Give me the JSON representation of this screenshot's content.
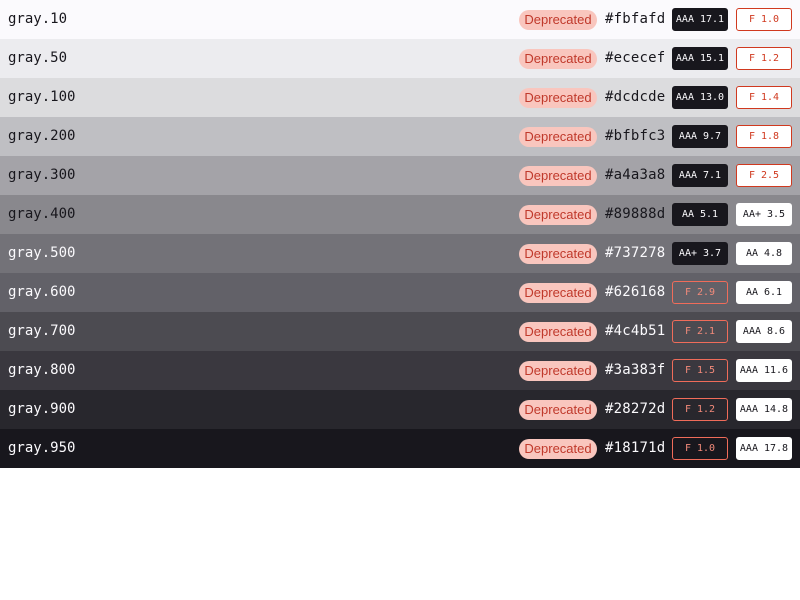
{
  "deprecated_label": "Deprecated",
  "colors": {
    "badge_bg": "#f9c6be",
    "badge_text": "#c0392b",
    "fail_border": "#d0391f"
  },
  "rows": [
    {
      "name": "gray.10",
      "hex": "#fbfafd",
      "bg": "#fbfafd",
      "fg": "#18171d",
      "dark_chip": "AAA 17.1",
      "light_chip": "F 1.0"
    },
    {
      "name": "gray.50",
      "hex": "#ececef",
      "bg": "#ececef",
      "fg": "#18171d",
      "dark_chip": "AAA 15.1",
      "light_chip": "F 1.2"
    },
    {
      "name": "gray.100",
      "hex": "#dcdcde",
      "bg": "#dcdcde",
      "fg": "#18171d",
      "dark_chip": "AAA 13.0",
      "light_chip": "F 1.4"
    },
    {
      "name": "gray.200",
      "hex": "#bfbfc3",
      "bg": "#bfbfc3",
      "fg": "#18171d",
      "dark_chip": "AAA 9.7",
      "light_chip": "F 1.8"
    },
    {
      "name": "gray.300",
      "hex": "#a4a3a8",
      "bg": "#a4a3a8",
      "fg": "#18171d",
      "dark_chip": "AAA 7.1",
      "light_chip": "F 2.5"
    },
    {
      "name": "gray.400",
      "hex": "#89888d",
      "bg": "#89888d",
      "fg": "#18171d",
      "dark_chip": "AA 5.1",
      "light_chip": "AA+ 3.5"
    },
    {
      "name": "gray.500",
      "hex": "#737278",
      "bg": "#737278",
      "fg": "#fbfafd",
      "dark_chip": "AA+ 3.7",
      "light_chip": "AA 4.8"
    },
    {
      "name": "gray.600",
      "hex": "#626168",
      "bg": "#626168",
      "fg": "#fbfafd",
      "dark_chip": "F 2.9",
      "light_chip": "AA 6.1"
    },
    {
      "name": "gray.700",
      "hex": "#4c4b51",
      "bg": "#4c4b51",
      "fg": "#fbfafd",
      "dark_chip": "F 2.1",
      "light_chip": "AAA 8.6"
    },
    {
      "name": "gray.800",
      "hex": "#3a383f",
      "bg": "#3a383f",
      "fg": "#fbfafd",
      "dark_chip": "F 1.5",
      "light_chip": "AAA 11.6"
    },
    {
      "name": "gray.900",
      "hex": "#28272d",
      "bg": "#28272d",
      "fg": "#fbfafd",
      "dark_chip": "F 1.2",
      "light_chip": "AAA 14.8"
    },
    {
      "name": "gray.950",
      "hex": "#18171d",
      "bg": "#18171d",
      "fg": "#fbfafd",
      "dark_chip": "F 1.0",
      "light_chip": "AAA 17.8"
    }
  ]
}
